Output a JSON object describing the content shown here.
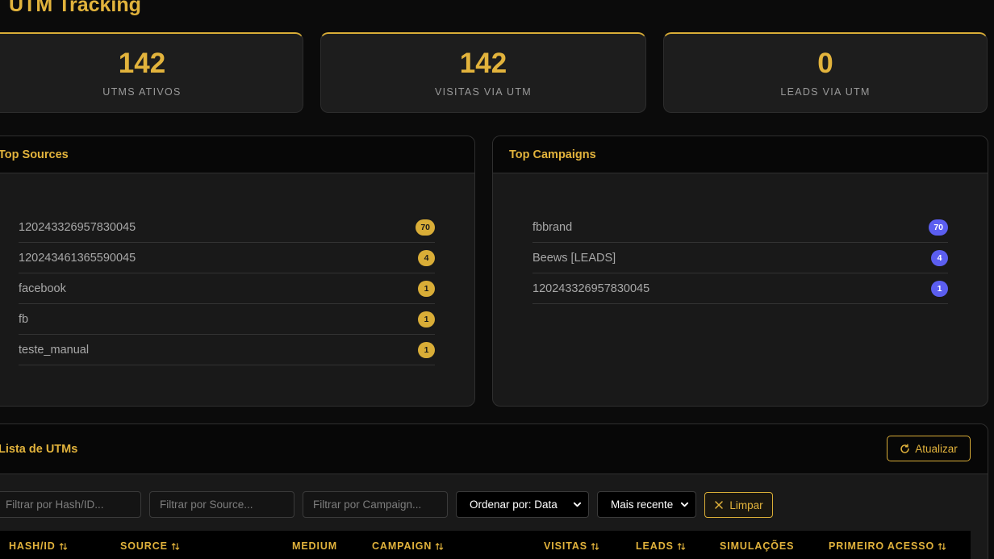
{
  "page": {
    "title": "UTM Tracking"
  },
  "stats": [
    {
      "value": "142",
      "label": "UTMS ATIVOS"
    },
    {
      "value": "142",
      "label": "VISITAS VIA UTM"
    },
    {
      "value": "0",
      "label": "LEADS VIA UTM"
    }
  ],
  "top_sources": {
    "title": "Top Sources",
    "items": [
      {
        "name": "120243326957830045",
        "count": "70"
      },
      {
        "name": "120243461365590045",
        "count": "4"
      },
      {
        "name": "facebook",
        "count": "1"
      },
      {
        "name": "fb",
        "count": "1"
      },
      {
        "name": "teste_manual",
        "count": "1"
      }
    ]
  },
  "top_campaigns": {
    "title": "Top Campaigns",
    "items": [
      {
        "name": "fbbrand",
        "count": "70"
      },
      {
        "name": "Beews [LEADS]",
        "count": "4"
      },
      {
        "name": "120243326957830045",
        "count": "1"
      }
    ]
  },
  "utm_list": {
    "title": "Lista de UTMs",
    "refresh_label": "Atualizar",
    "filters": {
      "hash_placeholder": "Filtrar por Hash/ID...",
      "source_placeholder": "Filtrar por Source...",
      "campaign_placeholder": "Filtrar por Campaign...",
      "sort_by_value": "Ordenar por: Data",
      "order_value": "Mais recente",
      "clear_label": "Limpar"
    },
    "columns": [
      "HASH/ID",
      "SOURCE",
      "MEDIUM",
      "CAMPAIGN",
      "VISITAS",
      "LEADS",
      "SIMULAÇÕES",
      "PRIMEIRO ACESSO"
    ]
  },
  "colors": {
    "accent": "#e2b33c",
    "badge_yellow": "#d9ad37",
    "badge_blue": "#5b5ef0",
    "background": "#0b0b0b",
    "card": "#1d1d1d"
  },
  "icons": {
    "refresh": "refresh-icon",
    "clear": "close-icon",
    "sort": "sort-icon",
    "select": "chevron-down-icon"
  }
}
